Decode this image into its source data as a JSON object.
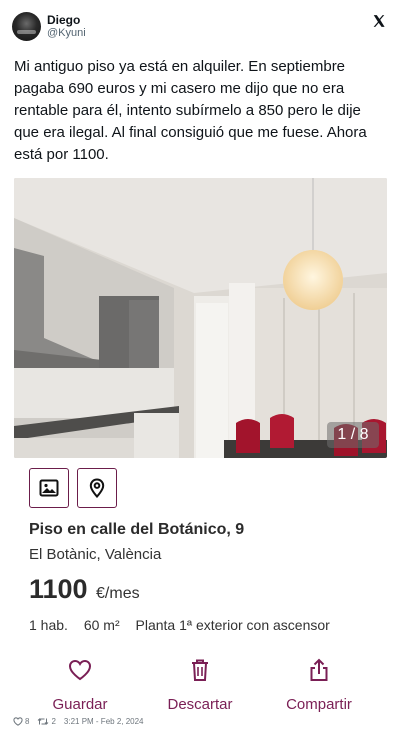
{
  "author": {
    "name": "Diego",
    "handle": "@Kyuni"
  },
  "tweet": {
    "text": "Mi antiguo piso ya está en alquiler. En septiembre pagaba 690 euros y mi casero me dijo que no era rentable para él, intento subírmelo a 850 pero le dije que era ilegal. Al final consiguió que me fuese. Ahora está por 1100."
  },
  "photo": {
    "counter": "1 / 8"
  },
  "listing": {
    "icons": [
      "image-icon",
      "location-pin-icon"
    ],
    "title": "Piso en calle del Botánico, 9",
    "location": "El Botànic, València",
    "price": "1100",
    "price_unit": "€/mes",
    "features": [
      "1 hab.",
      "60 m²",
      "Planta 1ª exterior con ascensor"
    ],
    "accent_color": "#7a1f55"
  },
  "actions": {
    "save": "Guardar",
    "discard": "Descartar",
    "share": "Compartir"
  },
  "meta": {
    "likes": "8",
    "retweets": "2",
    "timestamp": "3:21 PM - Feb 2, 2024"
  }
}
